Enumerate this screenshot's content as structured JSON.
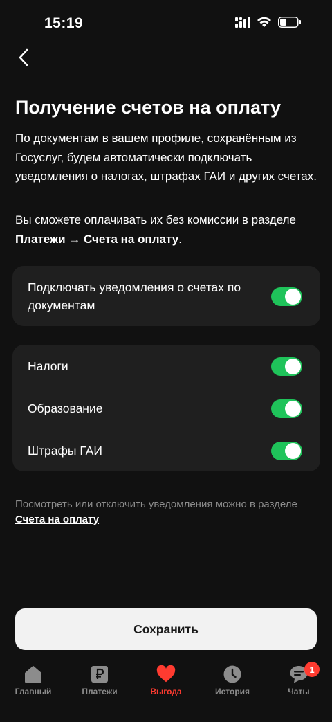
{
  "status_bar": {
    "time": "15:19"
  },
  "page": {
    "title": "Получение счетов на оплату",
    "description": "По документам в вашем профиле, сохранённым из Госуслуг, будем автоматически подключать уведомления о налогах, штрафах ГАИ и других счетах.",
    "pay_info_prefix": "Вы сможете оплачивать их без комиссии в разделе ",
    "pay_info_link": "Платежи → Счета на оплату",
    "pay_info_suffix": "."
  },
  "main_toggle": {
    "label": "Подключать уведомления о счетах по документам",
    "enabled": true
  },
  "categories": [
    {
      "label": "Налоги",
      "enabled": true
    },
    {
      "label": "Образование",
      "enabled": true
    },
    {
      "label": "Штрафы ГАИ",
      "enabled": true
    }
  ],
  "footnote": {
    "text": "Посмотреть или отключить уведомления можно в разделе ",
    "link": "Счета на оплату"
  },
  "save_button": {
    "label": "Сохранить"
  },
  "tabbar": {
    "tabs": [
      {
        "label": "Главный",
        "icon": "home-icon"
      },
      {
        "label": "Платежи",
        "icon": "ruble-icon"
      },
      {
        "label": "Выгода",
        "icon": "heart-icon",
        "active": true
      },
      {
        "label": "История",
        "icon": "clock-icon"
      },
      {
        "label": "Чаты",
        "icon": "chat-icon",
        "badge": "1"
      }
    ]
  },
  "colors": {
    "accent_green": "#1fc35a",
    "accent_red": "#ff3b30",
    "background": "#111111",
    "card": "#1f1f1f"
  }
}
